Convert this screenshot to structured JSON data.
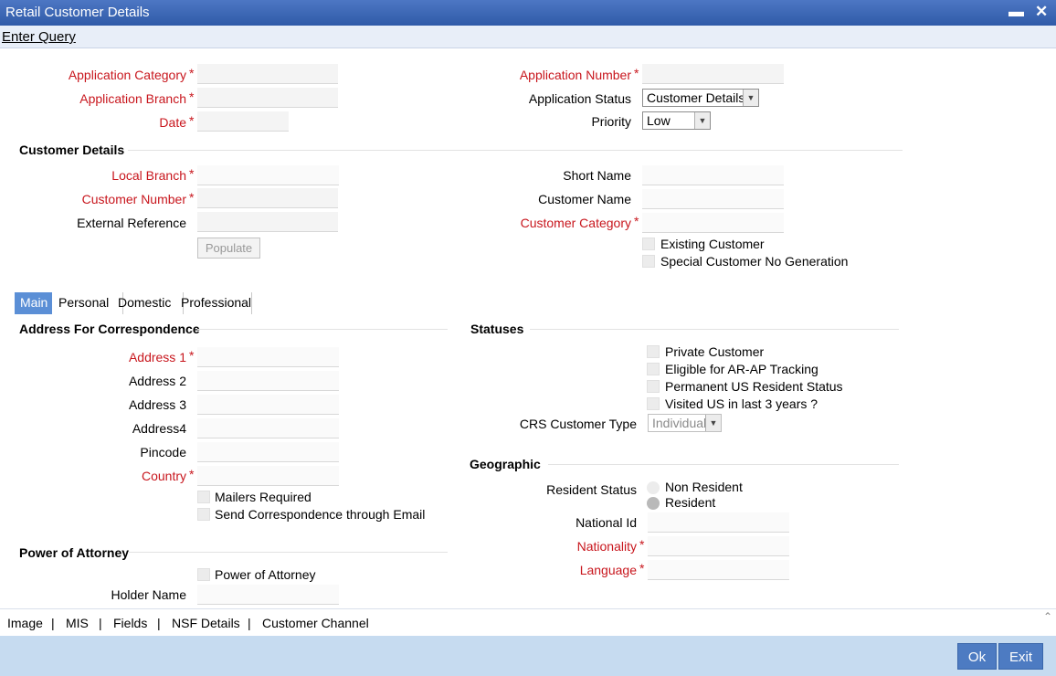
{
  "window": {
    "title": "Retail Customer Details",
    "minimize": "▬",
    "close": "✕"
  },
  "menu": {
    "enter_query": "Enter Query"
  },
  "app": {
    "application_category": "Application Category",
    "application_branch": "Application Branch",
    "date": "Date",
    "application_number": "Application Number",
    "application_status": "Application Status",
    "application_status_value": "Customer Details",
    "priority": "Priority",
    "priority_value": "Low"
  },
  "customer": {
    "section": "Customer Details",
    "local_branch": "Local Branch",
    "customer_number": "Customer Number",
    "external_reference": "External Reference",
    "populate": "Populate",
    "short_name": "Short Name",
    "customer_name": "Customer Name",
    "customer_category": "Customer Category",
    "existing_customer": "Existing Customer",
    "special_customer_no": "Special Customer No Generation"
  },
  "tabs": [
    "Main",
    "Personal",
    "Domestic",
    "Professional"
  ],
  "address": {
    "section": "Address For Correspondence",
    "address1": "Address 1",
    "address2": "Address 2",
    "address3": "Address 3",
    "address4": "Address4",
    "pincode": "Pincode",
    "country": "Country",
    "mailers_required": "Mailers Required",
    "send_email": "Send Correspondence through Email"
  },
  "poa": {
    "section": "Power of Attorney",
    "checkbox": "Power of Attorney",
    "holder_name": "Holder Name"
  },
  "statuses": {
    "section": "Statuses",
    "private_customer": "Private Customer",
    "eligible_arap": "Eligible for AR-AP Tracking",
    "permanent_us": "Permanent US Resident Status",
    "visited_us": "Visited US in last 3 years ?",
    "crs_type": "CRS Customer Type",
    "crs_type_value": "Individual"
  },
  "geo": {
    "section": "Geographic",
    "resident_status": "Resident Status",
    "non_resident": "Non Resident",
    "resident": "Resident",
    "national_id": "National Id",
    "nationality": "Nationality",
    "language": "Language"
  },
  "footer": {
    "links": [
      "Image",
      "MIS",
      "Fields",
      "NSF Details",
      "Customer Channel"
    ],
    "sep": "|"
  },
  "buttons": {
    "ok": "Ok",
    "exit": "Exit"
  },
  "required_mark": "*",
  "dropdown_arrow": "▼",
  "scroll_up": "⌃"
}
